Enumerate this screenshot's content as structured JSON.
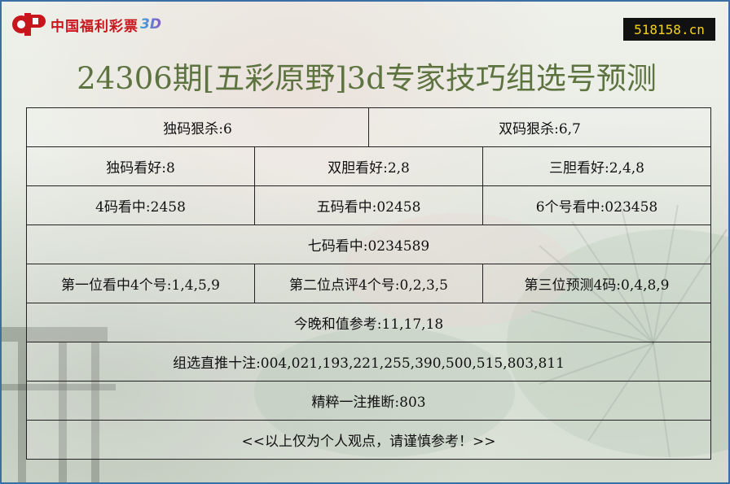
{
  "header": {
    "logo_text": "中国福利彩票",
    "logo_suffix": "3D",
    "site_badge": "518158.cn"
  },
  "title": "24306期[五彩原野]3d专家技巧组选号预测",
  "rows": {
    "r1": [
      "独码狠杀:6",
      "双码狠杀:6,7"
    ],
    "r2": [
      "独码看好:8",
      "双胆看好:2,8",
      "三胆看好:2,4,8"
    ],
    "r3": [
      "4码看中:2458",
      "五码看中:02458",
      "6个号看中:023458"
    ],
    "r4": [
      "七码看中:0234589"
    ],
    "r5": [
      "第一位看中4个号:1,4,5,9",
      "第二位点评4个号:0,2,3,5",
      "第三位预测4码:0,4,8,9"
    ],
    "r6": [
      "今晚和值参考:11,17,18"
    ],
    "r7": [
      "组选直推十注:004,021,193,221,255,390,500,515,803,811"
    ],
    "r8": [
      "精粹一注推断:803"
    ],
    "r9": [
      "<<以上仅为个人观点，请谨慎参考！>>"
    ]
  },
  "colors": {
    "border": "#3a6ea5",
    "title": "#5e7440",
    "logo_red": "#c8161d",
    "badge_bg": "#111111",
    "badge_fg": "#f5d21b"
  }
}
